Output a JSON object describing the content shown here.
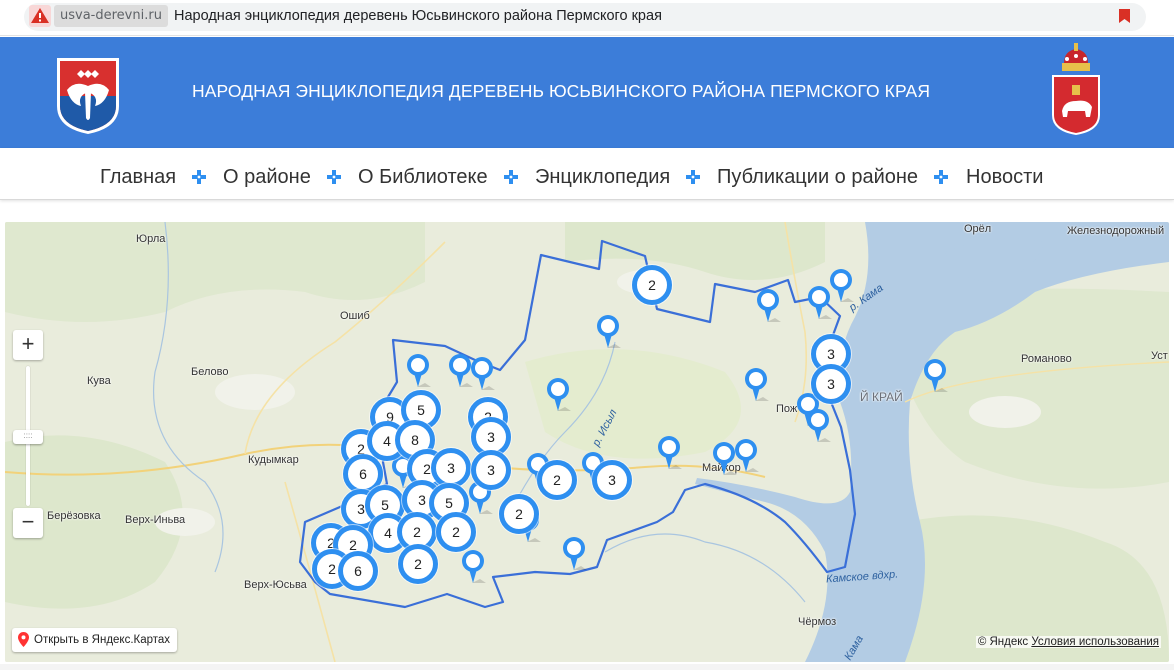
{
  "browser": {
    "domain": "usva-derevni.ru",
    "page_title": "Народная энциклопедия деревень Юсьвинского района Пермского края",
    "warning_icon": "warning-triangle-icon",
    "bookmark_icon": "bookmark-icon"
  },
  "header": {
    "title": "НАРОДНАЯ ЭНЦИКЛОПЕДИЯ ДЕРЕВЕНЬ ЮСЬВИНСКОГО РАЙОНА ПЕРМСКОГО КРАЯ",
    "left_logo_icon": "yusva-district-coat-of-arms-icon",
    "right_logo_icon": "perm-krai-coat-of-arms-icon",
    "bg_color": "#3c7dd9"
  },
  "nav": {
    "items": [
      "Главная",
      "О районе",
      "О Библиотеке",
      "Энциклопедия",
      "Публикации о районе",
      "Новости"
    ],
    "separator_icon": "blue-cross-icon",
    "separator_color": "#2e8ff0"
  },
  "map": {
    "places": {
      "yurla": "Юрла",
      "oshib": "Ошиб",
      "kuva": "Кува",
      "belovo": "Белово",
      "kudymkar": "Кудымкар",
      "berezovka": "Берёзовка",
      "verkh_inva": "Верх-Иньва",
      "verkh_yusva": "Верх-Юсьва",
      "orel": "Орёл",
      "zheleznodorozhny": "Железнодорожный",
      "romanovo": "Романово",
      "ust": "Уст",
      "krai": "Й КРАЙ",
      "pozh": "Пож",
      "maikor": "Майкор",
      "chermoz": "Чёрмоз"
    },
    "rivers": {
      "kama_top": "р. Кама",
      "isyl": "р. Исыл",
      "kamskoe": "Камское вдхр.",
      "kama_bottom": "Кама"
    },
    "clusters": [
      "2",
      "3",
      "3",
      "9",
      "5",
      "2",
      "4",
      "8",
      "2",
      "3",
      "6",
      "2",
      "3",
      "3",
      "3",
      "5",
      "3",
      "5",
      "2",
      "3",
      "2",
      "4",
      "2",
      "2",
      "2",
      "2",
      "6",
      "2",
      "2"
    ],
    "zoom_in": "+",
    "zoom_out": "−",
    "zoom_handle": "::::",
    "open_link": "Открыть в Яндекс.Картах",
    "copyright": "© Яндекс",
    "terms": "Условия использования",
    "accent": "#2e8ff0",
    "border_color": "#3a6fd8"
  }
}
